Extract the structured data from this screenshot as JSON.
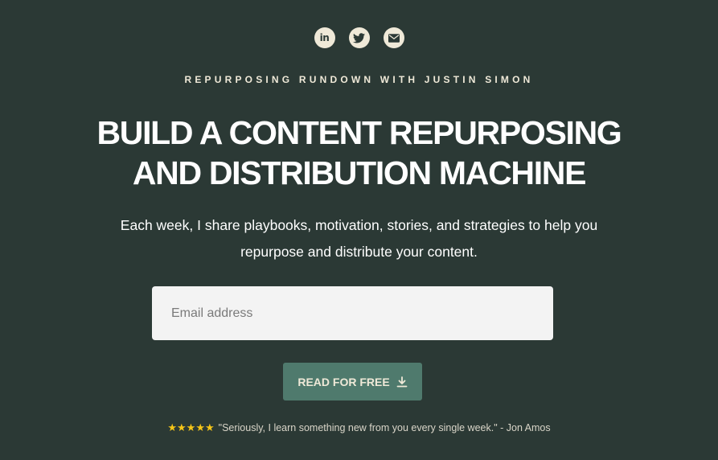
{
  "social": [
    {
      "name": "linkedin-icon",
      "label": "in"
    },
    {
      "name": "twitter-icon"
    },
    {
      "name": "email-icon"
    }
  ],
  "colors": {
    "background": "#2b3935",
    "accent": "#4f7a6d",
    "cream": "#efe9d8",
    "star": "#f5c518"
  },
  "eyebrow": "REPURPOSING RUNDOWN WITH JUSTIN SIMON",
  "headline": {
    "line1": "BUILD A CONTENT REPURPOSING",
    "line2": "AND DISTRIBUTION MACHINE"
  },
  "subtitle": {
    "line1": "Each week, I share playbooks, motivation, stories, and strategies to help you",
    "line2": "repurpose and distribute your content."
  },
  "form": {
    "email_placeholder": "Email address",
    "email_value": ""
  },
  "cta": {
    "label": "READ FOR FREE",
    "icon": "download-icon"
  },
  "testimonial": {
    "stars": "★★★★★",
    "rating": 5,
    "quote": "\"Seriously, I learn something new from you every single week.\" - Jon Amos"
  }
}
